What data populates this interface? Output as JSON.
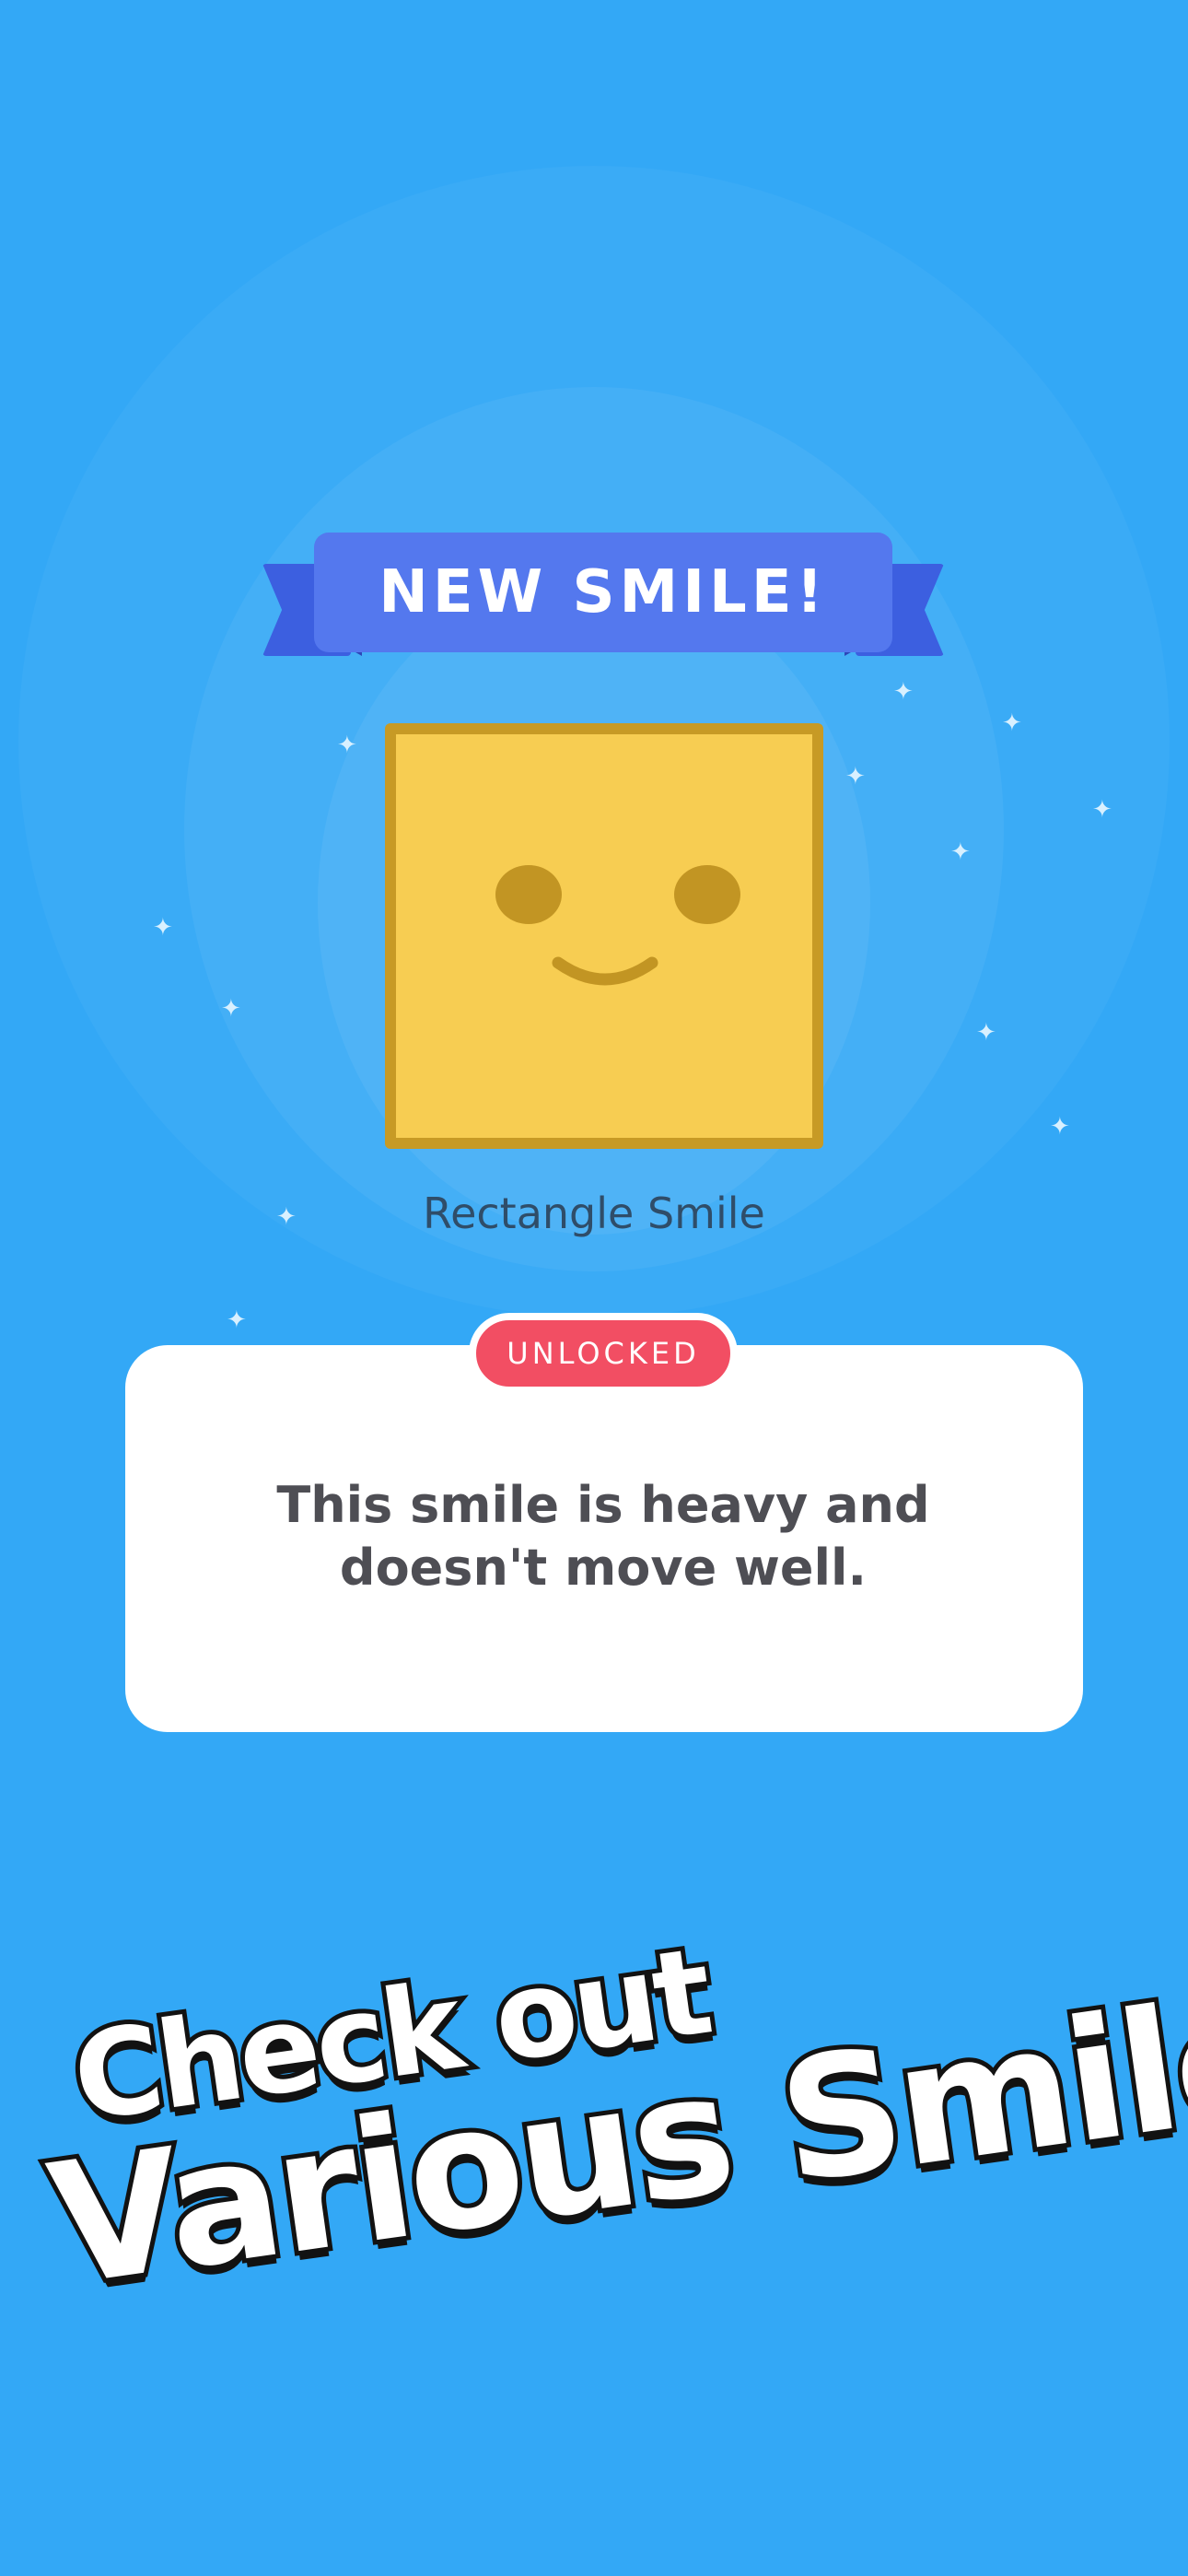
{
  "ribbon": {
    "title": "NEW SMILE!"
  },
  "smile": {
    "name": "Rectangle Smile",
    "face_color": "#f7cd52",
    "border_color": "#c79a25"
  },
  "unlock_card": {
    "badge": "UNLOCKED",
    "description_line1": "This smile is heavy and",
    "description_line2": "doesn't move well."
  },
  "promo": {
    "line1": "Check out",
    "line2": "Various Smile!"
  },
  "colors": {
    "background": "#33a8f6",
    "ribbon": "#5478ee",
    "badge": "#f24e63"
  },
  "icons": [
    "sparkle-icon",
    "smile-face-icon"
  ]
}
